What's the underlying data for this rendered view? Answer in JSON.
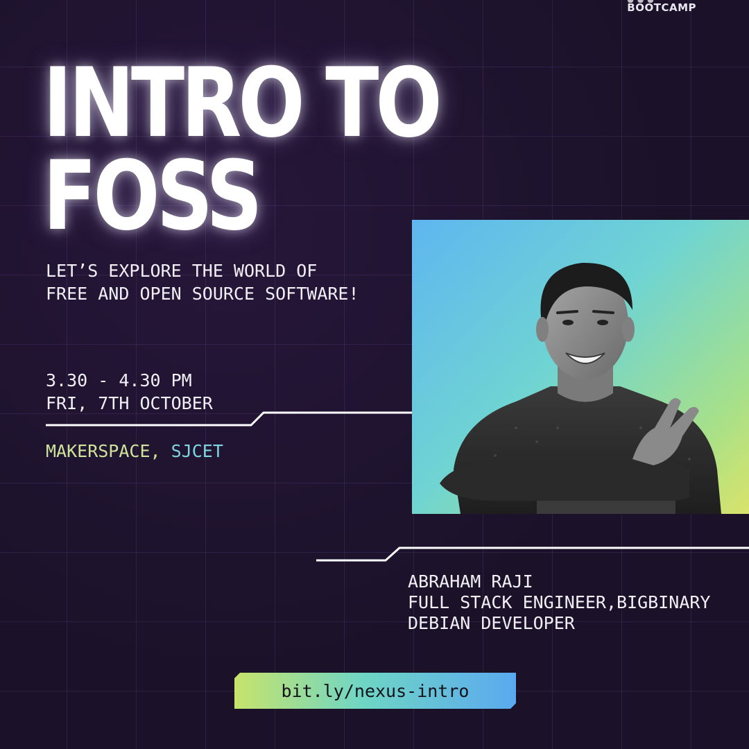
{
  "logo": {
    "text": "BOOTCAMP"
  },
  "title": {
    "line1": "INTRO TO",
    "line2": "FOSS"
  },
  "subtitle": {
    "line1": "LET’S EXPLORE THE WORLD OF",
    "line2": "FREE AND OPEN SOURCE SOFTWARE!"
  },
  "event": {
    "time": "3.30 - 4.30 PM",
    "date": "FRI, 7TH OCTOBER",
    "venue_place": "MAKERSPACE,",
    "venue_institution": "SJCET"
  },
  "speaker": {
    "name": "ABRAHAM RAJI",
    "role": "FULL STACK ENGINEER,BIGBINARY",
    "role2": "DEBIAN DEVELOPER"
  },
  "link": {
    "text": "bit.ly/nexus-intro"
  },
  "colors": {
    "background": "#1b1229",
    "grid": "#5a4585",
    "venue_place": "#cfe39a",
    "venue_institution": "#7fd6e0",
    "photo_gradient_start": "#5fb6f0",
    "photo_gradient_end": "#d9e36a"
  },
  "icons": {
    "photo": "speaker-photo",
    "divider": "connector-line"
  }
}
